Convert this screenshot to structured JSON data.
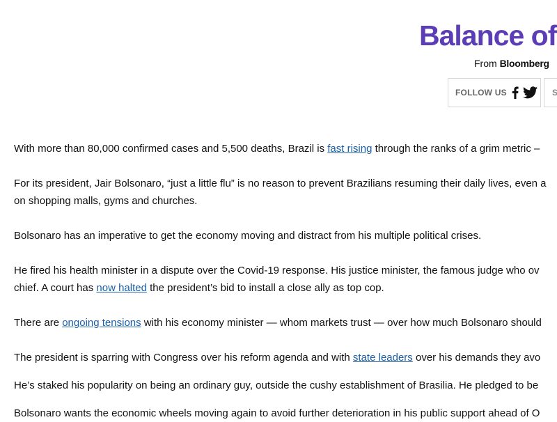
{
  "header": {
    "title": "Balance of",
    "source_prefix": "From ",
    "source_brand": "Bloomberg",
    "follow_label": "FOLLOW US",
    "share_label": "S"
  },
  "icons": {
    "facebook": "facebook-icon",
    "twitter": "twitter-icon"
  },
  "colors": {
    "title": "#5b3eb5",
    "link": "#1a5fa8"
  },
  "article": {
    "p1": {
      "a": "With more than 80,000 confirmed cases and 5,500 deaths, Brazil is ",
      "link": "fast rising",
      "b": " through the ranks of a grim metric –"
    },
    "p2": {
      "line1": "For its president, Jair Bolsonaro, “just a little flu” is no reason to prevent Brazilians resuming their daily lives, even a",
      "line2": "on shopping malls, gyms and churches."
    },
    "p3": "Bolsonaro has an imperative to get the economy moving and distract from his multiple political crises.",
    "p4": {
      "line1": "He fired his health minister in a dispute over the Covid-19 response. His justice minister, the famous judge who ov",
      "line2a": "chief. A court has ",
      "link": "now halted",
      "line2b": " the president’s bid to install a close ally as top cop."
    },
    "p5": {
      "a": "There are ",
      "link": "ongoing tensions",
      "b": " with his economy minister — whom markets trust — over how much Bolsonaro should"
    },
    "p6": {
      "a": "The president is sparring with Congress over his reform agenda and with ",
      "link": "state leaders",
      "b": " over his demands they avo"
    },
    "p7": "He’s staked his popularity on being an ordinary guy, outside the cushy establishment of Brasilia. He pledged to be",
    "p8": "Bolsonaro wants the economic wheels moving again to avoid further deterioration in his public support ahead of O"
  }
}
